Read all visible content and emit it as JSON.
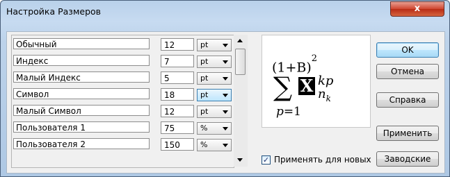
{
  "window": {
    "title": "Настройка Размеров",
    "close_label": "x"
  },
  "sizes": {
    "rows": [
      {
        "label": "Обычный",
        "value": "12",
        "unit": "pt"
      },
      {
        "label": "Индекс",
        "value": "7",
        "unit": "pt"
      },
      {
        "label": "Малый Индекс",
        "value": "5",
        "unit": "pt"
      },
      {
        "label": "Символ",
        "value": "18",
        "unit": "pt"
      },
      {
        "label": "Малый Символ",
        "value": "12",
        "unit": "pt"
      },
      {
        "label": "Пользователя 1",
        "value": "75",
        "unit": "%"
      },
      {
        "label": "Пользователя 2",
        "value": "150",
        "unit": "%"
      }
    ]
  },
  "preview": {
    "expr_base": "(1+B)",
    "expr_power": "2",
    "sigma": "∑",
    "var": "X",
    "sup": "kp",
    "sub_n": "n",
    "sub_k": "k",
    "lower_limit_var": "p",
    "lower_limit_rest": "=1"
  },
  "apply_new": {
    "checked": true,
    "label": "Применять для новых",
    "check_mark": "✓"
  },
  "buttons": {
    "ok": "OK",
    "cancel": "Отмена",
    "help": "Справка",
    "apply": "Применить",
    "factory": "Заводские"
  }
}
